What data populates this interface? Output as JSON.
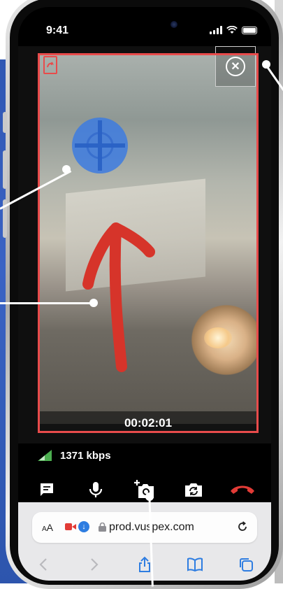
{
  "status_bar": {
    "time": "9:41"
  },
  "video": {
    "timer": "00:02:01",
    "border_color": "#e84b4b",
    "close_icon": "close-circle-icon",
    "swap_icon": "swap-camera-icon",
    "crosshair_color": "#3d7be0",
    "arrow_color": "#d6342a"
  },
  "connection": {
    "bitrate": "1371 kbps",
    "quality_icon": "signal-quality-icon"
  },
  "toolbar": {
    "items": [
      {
        "name": "chat",
        "icon": "chat-icon"
      },
      {
        "name": "microphone",
        "icon": "microphone-icon"
      },
      {
        "name": "snapshot",
        "icon": "add-photo-icon"
      },
      {
        "name": "switch-camera",
        "icon": "switch-camera-icon"
      },
      {
        "name": "end-call",
        "icon": "hang-up-icon",
        "color": "#e23b36"
      }
    ]
  },
  "browser": {
    "text_size_small": "A",
    "text_size_large": "A",
    "url": "prod.vuspex.com",
    "nav_icons": [
      "back-icon",
      "forward-icon",
      "share-icon",
      "bookmarks-icon",
      "tabs-icon"
    ],
    "accent": "#2e7de1"
  }
}
